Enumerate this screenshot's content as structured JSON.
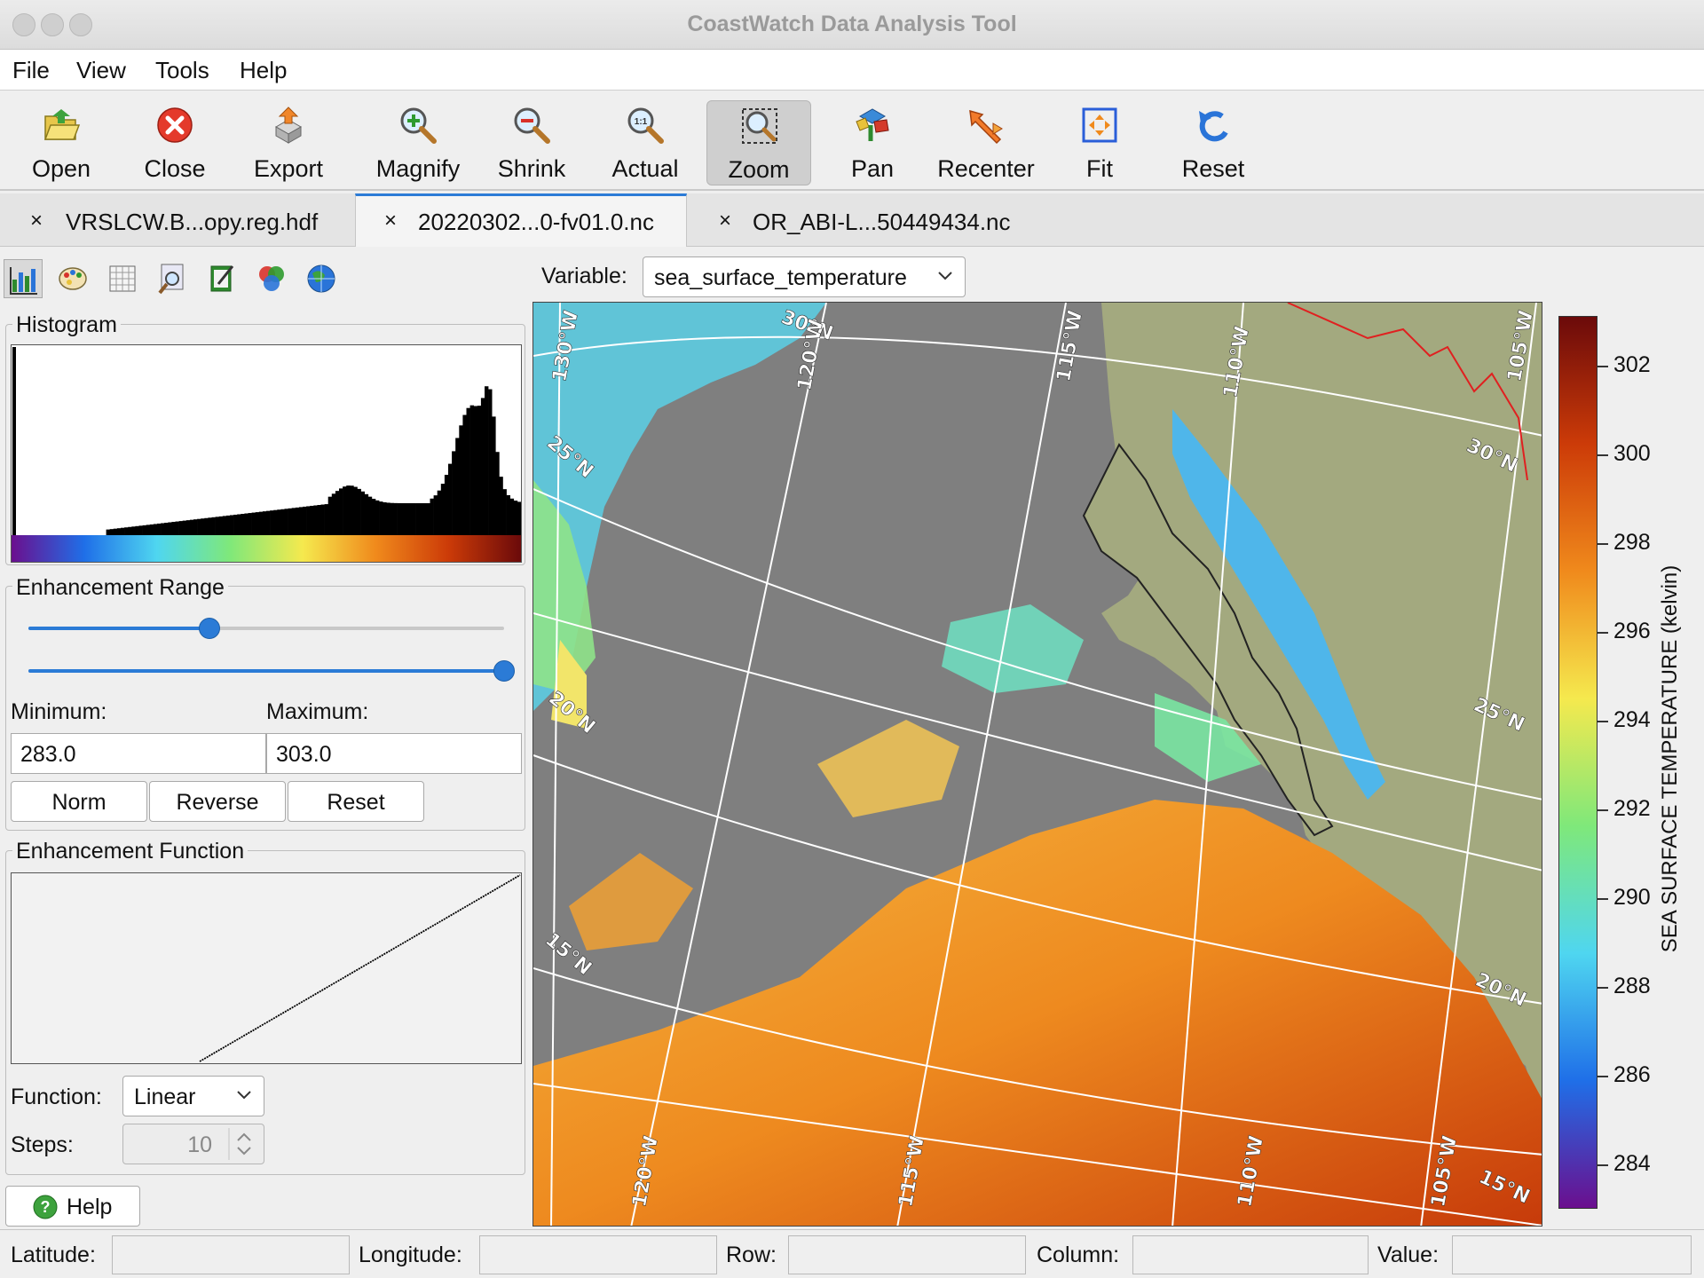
{
  "window": {
    "title": "CoastWatch Data Analysis Tool"
  },
  "menu": [
    "File",
    "View",
    "Tools",
    "Help"
  ],
  "toolbar": [
    {
      "label": "Open",
      "icon": "folder-open-icon"
    },
    {
      "label": "Close",
      "icon": "close-red-icon"
    },
    {
      "label": "Export",
      "icon": "export-icon"
    },
    {
      "label": "Magnify",
      "icon": "magnify-icon"
    },
    {
      "label": "Shrink",
      "icon": "shrink-icon"
    },
    {
      "label": "Actual",
      "icon": "actual-size-icon"
    },
    {
      "label": "Zoom",
      "icon": "zoom-icon",
      "active": true
    },
    {
      "label": "Pan",
      "icon": "pan-icon"
    },
    {
      "label": "Recenter",
      "icon": "recenter-icon"
    },
    {
      "label": "Fit",
      "icon": "fit-icon"
    },
    {
      "label": "Reset",
      "icon": "reset-icon"
    }
  ],
  "tabs": [
    {
      "label": "VRSLCW.B...opy.reg.hdf",
      "close": "×"
    },
    {
      "label": "20220302...0-fv01.0.nc",
      "close": "×",
      "active": true
    },
    {
      "label": "OR_ABI-L...50449434.nc",
      "close": "×"
    }
  ],
  "variable": {
    "label": "Variable:",
    "value": "sea_surface_temperature"
  },
  "histogram": {
    "title": "Histogram"
  },
  "enhancement_range": {
    "title": "Enhancement Range",
    "min_label": "Minimum:",
    "max_label": "Maximum:",
    "min_value": "283.0",
    "max_value": "303.0",
    "slider_min_fraction": 0.38,
    "slider_max_fraction": 1.0,
    "buttons": [
      "Norm",
      "Reverse",
      "Reset"
    ]
  },
  "enhancement_function": {
    "title": "Enhancement Function",
    "function_label": "Function:",
    "function_value": "Linear",
    "steps_label": "Steps:",
    "steps_value": "10"
  },
  "help_button": "Help",
  "map": {
    "lat_labels": [
      "30°N",
      "25°N",
      "20°N",
      "15°N",
      "30°N",
      "25°N",
      "20°N",
      "15°N"
    ],
    "lon_labels_top": [
      "130°W",
      "120°W",
      "115°W",
      "110°W",
      "105°W"
    ],
    "lon_labels_bottom": [
      "120°W",
      "115°W",
      "110°W",
      "105°W"
    ]
  },
  "colorbar": {
    "title": "SEA SURFACE TEMPERATURE (kelvin)",
    "ticks": [
      "302",
      "300",
      "298",
      "296",
      "294",
      "292",
      "290",
      "288",
      "286",
      "284"
    ],
    "colors": {
      "c1": "#6b0f8e",
      "c2": "#1f6fe8",
      "c3": "#4fd6f0",
      "c4": "#7fe87a",
      "c5": "#f5e94e",
      "c6": "#f08a1c",
      "c7": "#cc3b08",
      "c8": "#6b0a0a"
    }
  },
  "status": {
    "latitude": "Latitude:",
    "longitude": "Longitude:",
    "row": "Row:",
    "column": "Column:",
    "value": "Value:"
  }
}
